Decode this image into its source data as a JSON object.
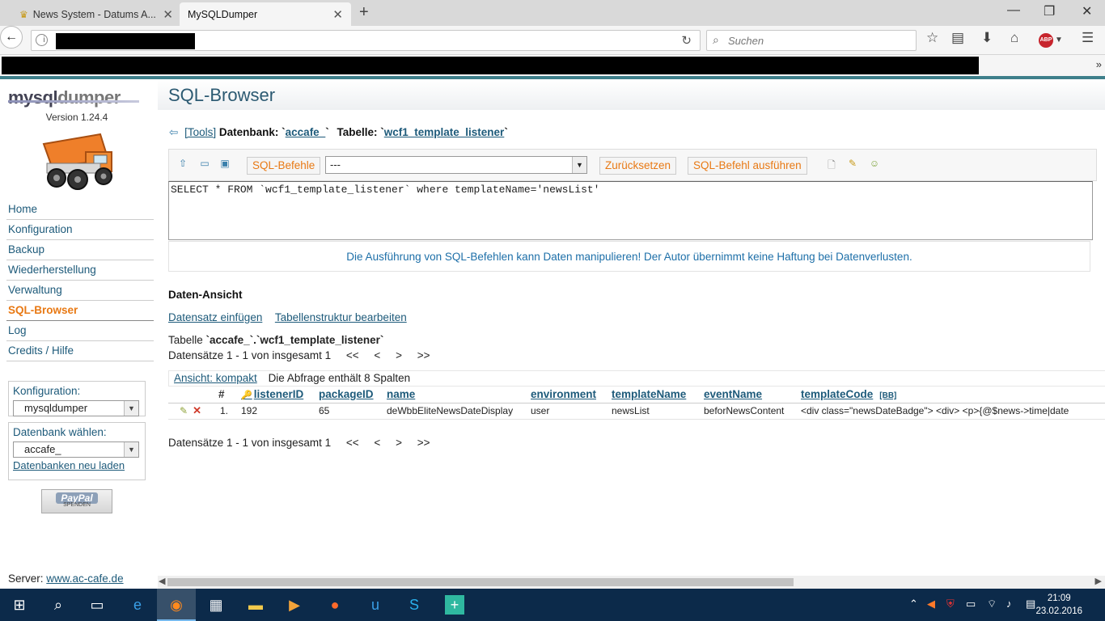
{
  "browser": {
    "tabs": [
      {
        "title": "News System - Datums A..."
      },
      {
        "title": "MySQLDumper"
      }
    ],
    "search_placeholder": "Suchen",
    "abp_label": "ABP"
  },
  "sidebar": {
    "logo_left": "mysql",
    "logo_right": "dumper",
    "version": "Version 1.24.4",
    "menu": [
      {
        "label": "Home"
      },
      {
        "label": "Konfiguration"
      },
      {
        "label": "Backup"
      },
      {
        "label": "Wiederherstellung"
      },
      {
        "label": "Verwaltung"
      },
      {
        "label": "SQL-Browser",
        "active": true
      },
      {
        "label": "Log"
      },
      {
        "label": "Credits / Hilfe"
      }
    ],
    "config_label": "Konfiguration:",
    "config_value": "mysqldumper",
    "db_label": "Datenbank wählen:",
    "db_value": "accafe_",
    "reload_link": "Datenbanken neu laden",
    "paypal_label": "PayPal",
    "paypal_sub": "SPENDEN",
    "server_label": "Server:",
    "server_link": "www.ac-cafe.de"
  },
  "main": {
    "title": "SQL-Browser",
    "breadcrumb": {
      "tools": "[Tools]",
      "db_label": "Datenbank:",
      "db_name": "accafe_",
      "table_label": "Tabelle:",
      "table_name": "wcf1_template_listener"
    },
    "toolbar": {
      "sql_commands": "SQL-Befehle",
      "select_value": "---",
      "reset": "Zurücksetzen",
      "execute": "SQL-Befehl ausführen"
    },
    "query": "SELECT * FROM `wcf1_template_listener` where templateName='newsList'",
    "warning": "Die Ausführung von SQL-Befehlen kann Daten manipulieren! Der Autor übernimmt keine Haftung bei Datenverlusten.",
    "section_title": "Daten-Ansicht",
    "insert_link": "Datensatz einfügen",
    "edit_struct_link": "Tabellenstruktur bearbeiten",
    "table_prefix": "Tabelle",
    "table_full": "`accafe_`.`wcf1_template_listener`",
    "records_text": "Datensätze 1 - 1 von insgesamt 1",
    "pager": [
      "<<",
      "<",
      ">",
      ">>"
    ],
    "view_link": "Ansicht: kompakt",
    "columns_info": "Die Abfrage enthält 8 Spalten",
    "columns": [
      "#",
      "listenerID",
      "packageID",
      "name",
      "environment",
      "templateName",
      "eventName",
      "templateCode"
    ],
    "bb_label": "[BB]",
    "rows": [
      {
        "num": "1.",
        "listenerID": "192",
        "packageID": "65",
        "name": "deWbbEliteNewsDateDisplay",
        "environment": "user",
        "templateName": "newsList",
        "eventName": "beforNewsContent",
        "templateCode": "<div class=\"newsDateBadge\"> <div> <p>{@$news->time|date"
      }
    ]
  },
  "taskbar": {
    "time": "21:09",
    "date": "23.02.2016"
  },
  "colors": {
    "accent_orange": "#e87914",
    "link_blue": "#1d5a7a",
    "teal_bar": "#3e7f8a",
    "taskbar": "#0c2a4a"
  }
}
